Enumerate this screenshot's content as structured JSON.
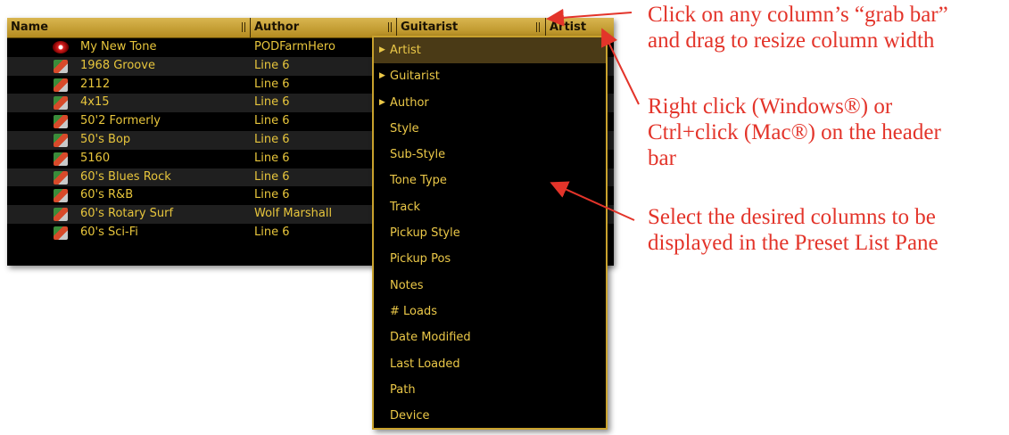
{
  "header": {
    "columns": [
      {
        "label": "Name"
      },
      {
        "label": "Author"
      },
      {
        "label": "Guitarist"
      },
      {
        "label": "Artist"
      }
    ]
  },
  "presets": [
    {
      "name": "My New Tone",
      "author": "PODFarmHero",
      "icon": "tone-icon"
    },
    {
      "name": "1968 Groove",
      "author": "Line 6",
      "icon": "amp-icon"
    },
    {
      "name": "2112",
      "author": "Line 6",
      "icon": "amp-icon"
    },
    {
      "name": "4x15",
      "author": "Line 6",
      "icon": "amp-icon"
    },
    {
      "name": "50'2 Formerly",
      "author": "Line 6",
      "icon": "amp-icon"
    },
    {
      "name": "50's Bop",
      "author": "Line 6",
      "icon": "amp-icon"
    },
    {
      "name": "5160",
      "author": "Line 6",
      "icon": "amp-icon"
    },
    {
      "name": "60's Blues Rock",
      "author": "Line 6",
      "icon": "amp-icon"
    },
    {
      "name": "60's R&B",
      "author": "Line 6",
      "icon": "amp-icon"
    },
    {
      "name": "60's Rotary Surf",
      "author": "Wolf Marshall",
      "icon": "amp-icon"
    },
    {
      "name": "60's Sci-Fi",
      "author": "Line 6",
      "icon": "amp-icon"
    }
  ],
  "context_menu": {
    "items": [
      {
        "label": "Artist",
        "checked": true,
        "selected": true
      },
      {
        "label": "Guitarist",
        "checked": true
      },
      {
        "label": "Author",
        "checked": true
      },
      {
        "label": "Style"
      },
      {
        "label": "Sub-Style"
      },
      {
        "label": "Tone Type"
      },
      {
        "label": "Track"
      },
      {
        "label": "Pickup Style"
      },
      {
        "label": "Pickup Pos"
      },
      {
        "label": "Notes"
      },
      {
        "label": "# Loads"
      },
      {
        "label": "Date Modified"
      },
      {
        "label": "Last Loaded"
      },
      {
        "label": "Path"
      },
      {
        "label": "Device"
      }
    ]
  },
  "annotations": {
    "a1_line1": "Click on any column’s “grab bar”",
    "a1_line2": "and drag to resize column width",
    "a2_line1": "Right click (Windows®) or",
    "a2_line2": "Ctrl+click (Mac®) on the header",
    "a2_line3": "bar",
    "a3_line1": "Select the desired columns to be",
    "a3_line2": "displayed in the Preset List Pane"
  },
  "colors": {
    "accent": "#ebc848",
    "header": "#c9a22d",
    "annotation": "#e3342a"
  }
}
